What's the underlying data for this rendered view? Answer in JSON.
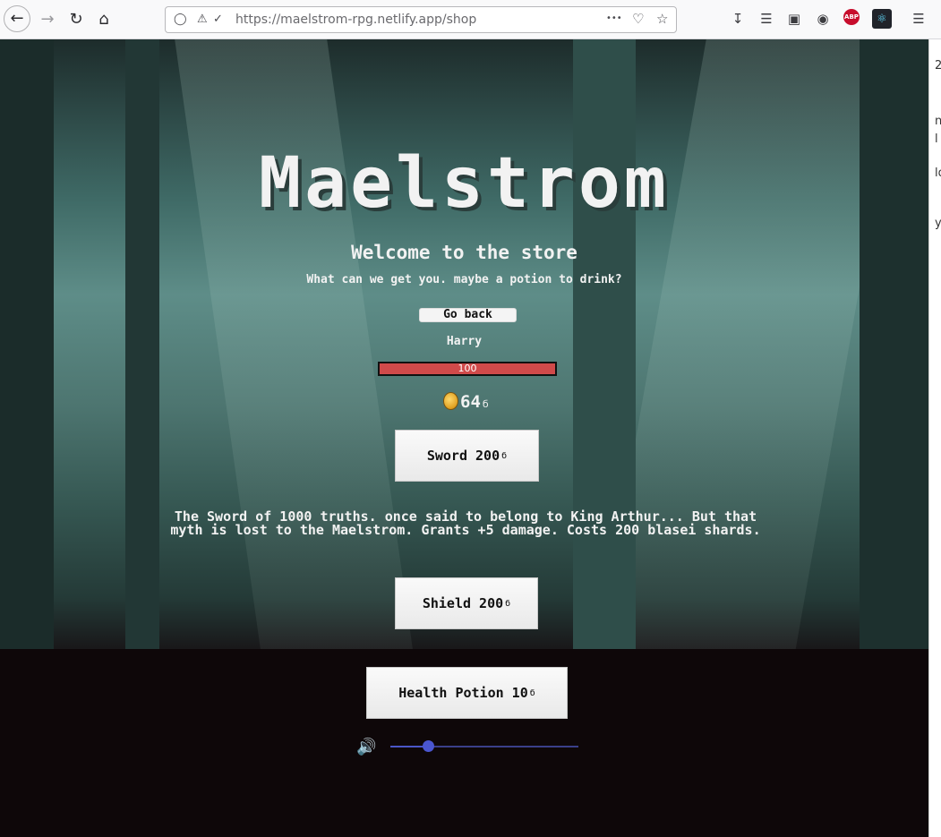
{
  "browser": {
    "url": "https://maelstrom-rpg.netlify.app/shop",
    "menu_dots": "•••"
  },
  "game": {
    "title": "Maelstrom",
    "welcome": "Welcome to the store",
    "tagline": "What can we get you. maybe a potion to drink?",
    "go_back_label": "Go back",
    "player_name": "Harry",
    "health_label": "100",
    "health_fraction": 1.0,
    "gold_amount": "64",
    "currency_symbol": "б",
    "items": [
      {
        "label": "Sword 200"
      },
      {
        "label": "Shield 200"
      },
      {
        "label": "Health Potion 10"
      }
    ],
    "sword_description": "The Sword of 1000 truths. once said to belong to King Arthur... But that myth is lost to the Maelstrom. Grants +5 damage. Costs 200 blasei shards.",
    "volume_fraction": 0.2
  },
  "side_strip": [
    "2",
    "n",
    "l",
    "ld",
    "y"
  ],
  "colors": {
    "hp": "#d04a4a",
    "slider": "#4a56d0"
  },
  "icons": {
    "back": "back-arrow-icon",
    "forward": "forward-arrow-icon",
    "reload": "reload-icon",
    "home": "home-icon",
    "speaker": "speaker-icon",
    "coin": "coin-icon"
  }
}
